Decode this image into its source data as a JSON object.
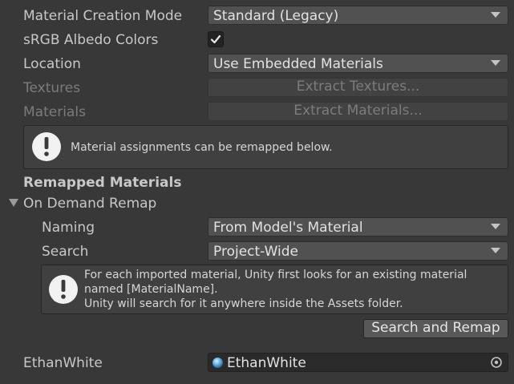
{
  "material_creation_mode": {
    "label": "Material Creation Mode",
    "value": "Standard (Legacy)"
  },
  "srgb_albedo": {
    "label": "sRGB Albedo Colors",
    "checked": true
  },
  "location": {
    "label": "Location",
    "value": "Use Embedded Materials"
  },
  "textures": {
    "label": "Textures",
    "button": "Extract Textures..."
  },
  "materials": {
    "label": "Materials",
    "button": "Extract Materials..."
  },
  "help_remap": {
    "text": "Material assignments can be remapped below."
  },
  "remapped_header": "Remapped Materials",
  "on_demand": {
    "label": "On Demand Remap",
    "expanded": true,
    "naming": {
      "label": "Naming",
      "value": "From Model's Material"
    },
    "search": {
      "label": "Search",
      "value": "Project-Wide"
    },
    "help": {
      "line1": "For each imported material, Unity first looks for an existing material",
      "line2": "named [MaterialName].",
      "line3": "Unity will search for it anywhere inside the Assets folder."
    },
    "search_remap_button": "Search and Remap"
  },
  "material_slot": {
    "label": "EthanWhite",
    "value": "EthanWhite"
  },
  "colors": {
    "background": "#383838",
    "field": "#515151",
    "help_box": "#404040"
  }
}
